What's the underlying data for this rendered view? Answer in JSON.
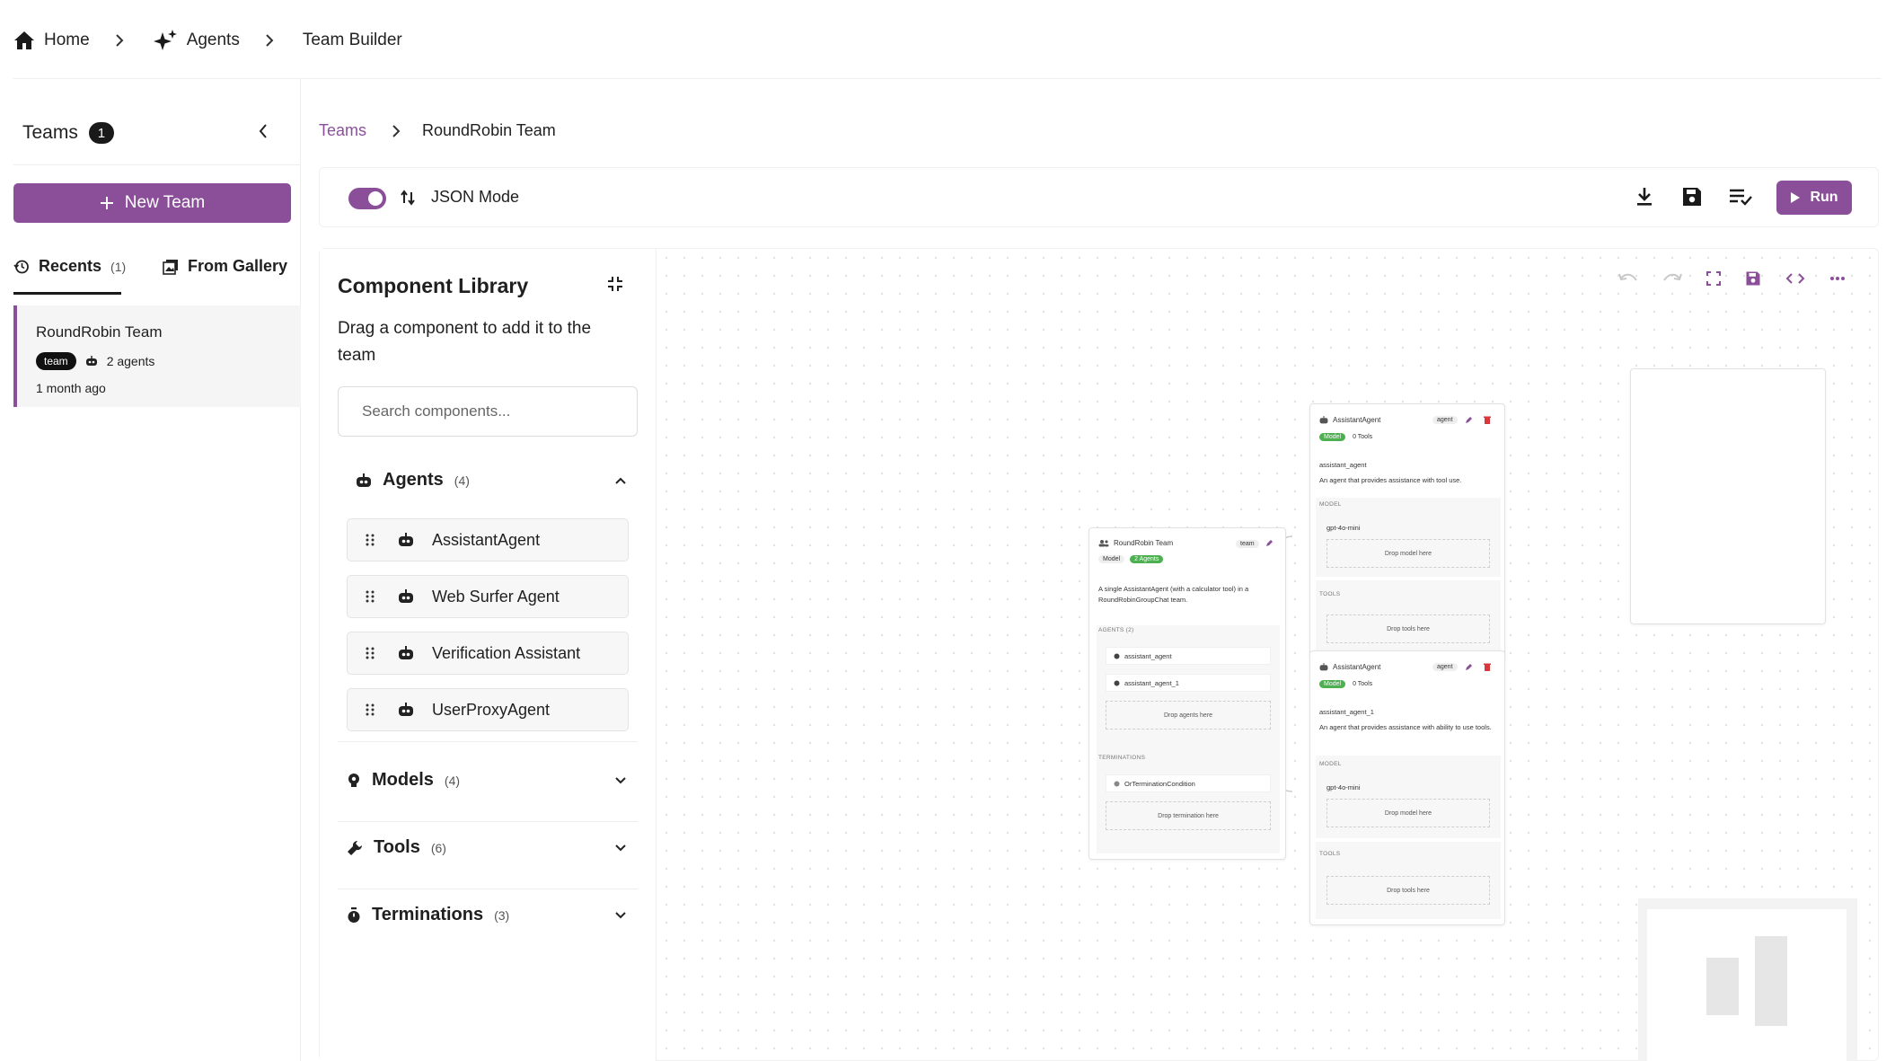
{
  "topbar": {
    "items": [
      {
        "label": "Home",
        "icon": "home-icon"
      },
      {
        "label": "Agents",
        "icon": "sparkles-icon"
      },
      {
        "label": "Team Builder"
      }
    ]
  },
  "sidebar": {
    "title": "Teams",
    "count": "1",
    "new_team_label": "New Team",
    "tabs": [
      {
        "label": "Recents",
        "count": "(1)"
      },
      {
        "label": "From Gallery"
      }
    ],
    "team": {
      "name": "RoundRobin Team",
      "badge": "team",
      "agents": "2 agents",
      "ago": "1 month ago"
    }
  },
  "breadcrumb": {
    "parent": "Teams",
    "current": "RoundRobin Team"
  },
  "toolbar": {
    "json_mode_label": "JSON Mode",
    "run_label": "Run"
  },
  "library": {
    "title": "Component Library",
    "description": "Drag a component to add it to the team",
    "search_placeholder": "Search components...",
    "sections": [
      {
        "label": "Agents",
        "count": "(4)",
        "expanded": true,
        "items": [
          "AssistantAgent",
          "Web Surfer Agent",
          "Verification Assistant",
          "UserProxyAgent"
        ]
      },
      {
        "label": "Models",
        "count": "(4)"
      },
      {
        "label": "Tools",
        "count": "(6)"
      },
      {
        "label": "Terminations",
        "count": "(3)"
      }
    ]
  },
  "team_node": {
    "title": "RoundRobin Team",
    "badge": "team",
    "model_label": "Model",
    "agents_pill": "2 Agents",
    "description": "A single AssistantAgent (with a calculator tool) in a RoundRobinGroupChat team.",
    "agents_caption": "AGENTS (2)",
    "agents": [
      "assistant_agent",
      "assistant_agent_1"
    ],
    "drop_agents": "Drop agents here",
    "terminations_caption": "TERMINATIONS",
    "termination": "OrTerminationCondition",
    "drop_termination": "Drop termination here"
  },
  "agent_nodes": [
    {
      "title": "AssistantAgent",
      "badge": "agent",
      "model_pill": "Model",
      "tools": "0 Tools",
      "name": "assistant_agent",
      "description": "An agent that provides assistance with tool use.",
      "model_caption": "MODEL",
      "model": "gpt-4o-mini",
      "drop_model": "Drop model here",
      "tools_caption": "TOOLS",
      "drop_tools": "Drop tools here"
    },
    {
      "title": "AssistantAgent",
      "badge": "agent",
      "model_pill": "Model",
      "tools": "0 Tools",
      "name": "assistant_agent_1",
      "description": "An agent that provides assistance with ability to use tools.",
      "model_caption": "MODEL",
      "model": "gpt-4o-mini",
      "drop_model": "Drop model here",
      "tools_caption": "TOOLS",
      "drop_tools": "Drop tools here"
    }
  ],
  "colors": {
    "accent": "#8b4f99",
    "green": "#4caf50"
  }
}
